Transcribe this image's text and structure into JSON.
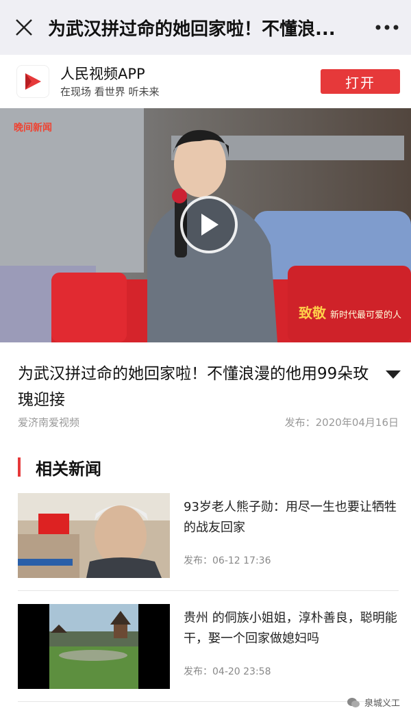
{
  "navbar": {
    "title": "为武汉拼过命的她回家啦！不懂浪..."
  },
  "app_banner": {
    "name": "人民视频APP",
    "slogan": "在现场 看世界 听未来",
    "open_label": "打开"
  },
  "video": {
    "channel_logo": "晚间新闻",
    "badge_main": "致敬",
    "badge_sub": "新时代最可爱的人"
  },
  "article": {
    "title": "为武汉拼过命的她回家啦！不懂浪漫的他用99朵玫瑰迎接",
    "source": "爱济南爱视频",
    "published": "发布：2020年04月16日"
  },
  "related": {
    "heading": "相关新闻",
    "items": [
      {
        "title": "93岁老人熊子勋：用尽一生也要让牺牲的战友回家",
        "time": "发布：06-12 17:36"
      },
      {
        "title": "贵州 的侗族小姐姐，淳朴善良，聪明能干，娶一个回家做媳妇吗",
        "time": "发布：04-20 23:58"
      }
    ]
  },
  "watermark": {
    "text": "泉城义工"
  },
  "icons": {
    "close": "close-icon",
    "more": "more-icon",
    "play": "play-icon",
    "expand": "chevron-down-icon",
    "app_logo": "play-logo-icon"
  },
  "colors": {
    "accent": "#e6393a",
    "navbar_bg": "#efeff4"
  }
}
